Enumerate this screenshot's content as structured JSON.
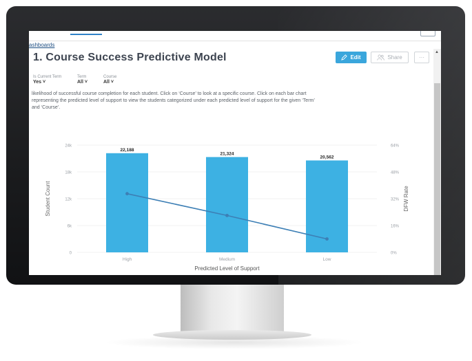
{
  "breadcrumb": "ashboards",
  "title": "1. Course Success Predictive Model",
  "buttons": {
    "edit": "Edit",
    "share": "Share",
    "more": "···"
  },
  "filters": [
    {
      "label": "Is Current Term",
      "value": "Yes ˅"
    },
    {
      "label": "Term",
      "value": "All ˅"
    },
    {
      "label": "Course",
      "value": "All ˅"
    }
  ],
  "description": [
    "likelihood of successful course completion for each student. Click on ‘Course’ to look at a specific course. Click on each bar chart",
    "representing the predicted level of support to view the students categorized under each predicted level of support for the given ‘Term’",
    "and ‘Course’."
  ],
  "chart_data": {
    "type": "bar",
    "categories": [
      "High",
      "Medium",
      "Low"
    ],
    "series": [
      {
        "values": [
          22188,
          21324,
          20562
        ],
        "value_labels": [
          "22,188",
          "21,324",
          "20,562"
        ],
        "axis": "left",
        "type": "bar",
        "color": "#3db1e3"
      },
      {
        "values": [
          35,
          22,
          8
        ],
        "axis": "right",
        "type": "line",
        "color": "#3d7fb5"
      }
    ],
    "xlabel": "Predicted Level of Support",
    "ylabel": "Student Count",
    "y2label": "DFW Rate",
    "ylim": [
      0,
      24000
    ],
    "y2lim": [
      0,
      64
    ],
    "yticks": [
      "0",
      "6k",
      "12k",
      "18k",
      "24k"
    ],
    "y2ticks": [
      "0%",
      "16%",
      "32%",
      "48%",
      "64%"
    ],
    "grid": true
  }
}
